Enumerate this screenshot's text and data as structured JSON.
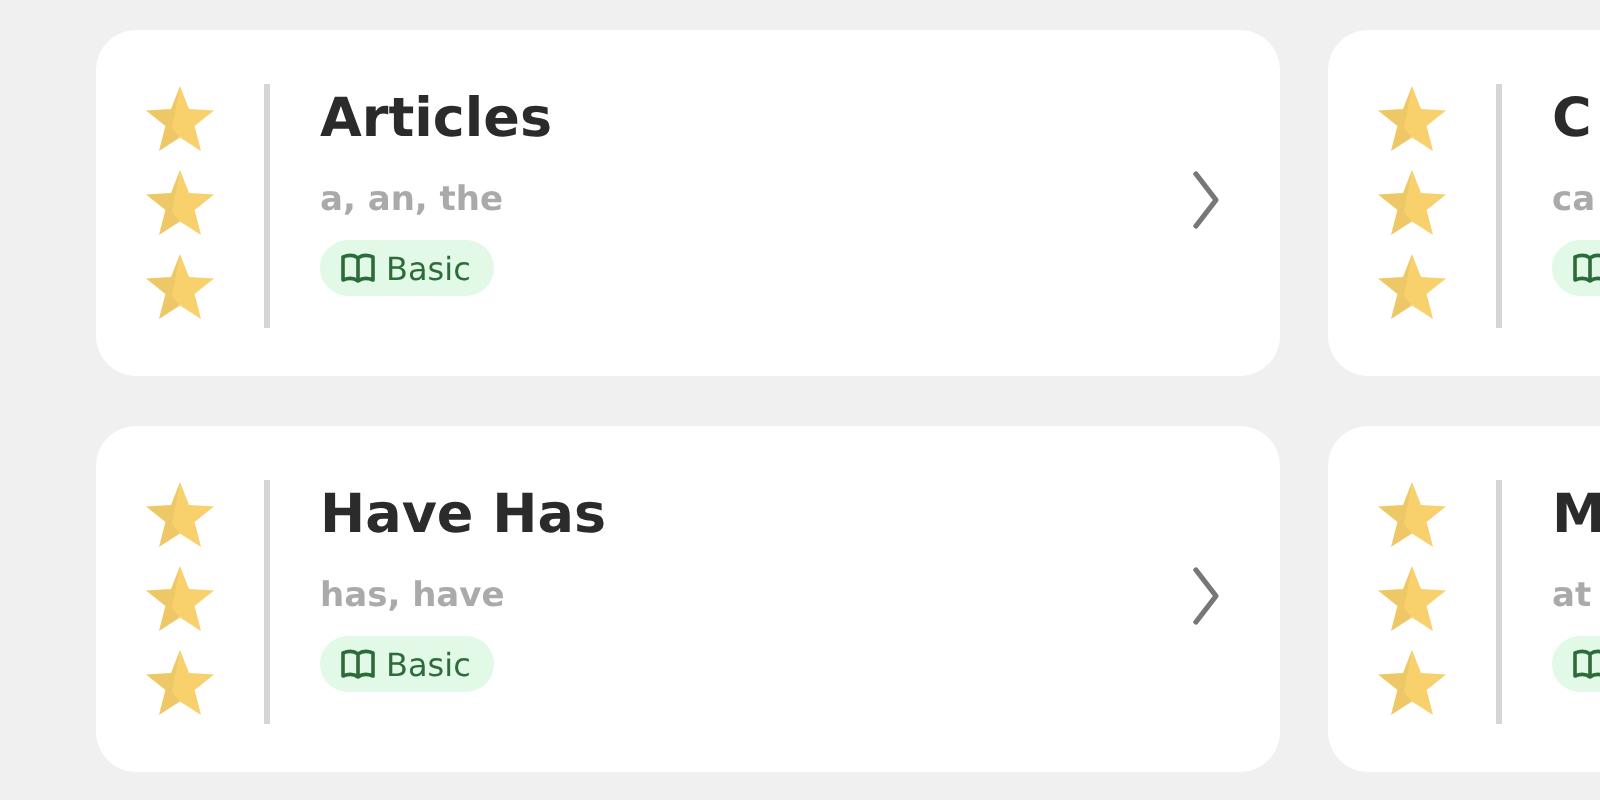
{
  "cards": [
    {
      "title": "Articles",
      "subtitle": "a, an, the",
      "badge": {
        "kind": "book",
        "label": "Basic"
      },
      "chevron": true
    },
    {
      "title": "C",
      "subtitle": "ca",
      "badge": {
        "kind": "book"
      },
      "chevron": false
    },
    {
      "title": "Have Has",
      "subtitle": "has, have",
      "badge": {
        "kind": "book",
        "label": "Basic"
      },
      "chevron": true
    },
    {
      "title": "M",
      "subtitle": "at",
      "badge": {
        "kind": "book"
      },
      "chevron": false
    }
  ]
}
